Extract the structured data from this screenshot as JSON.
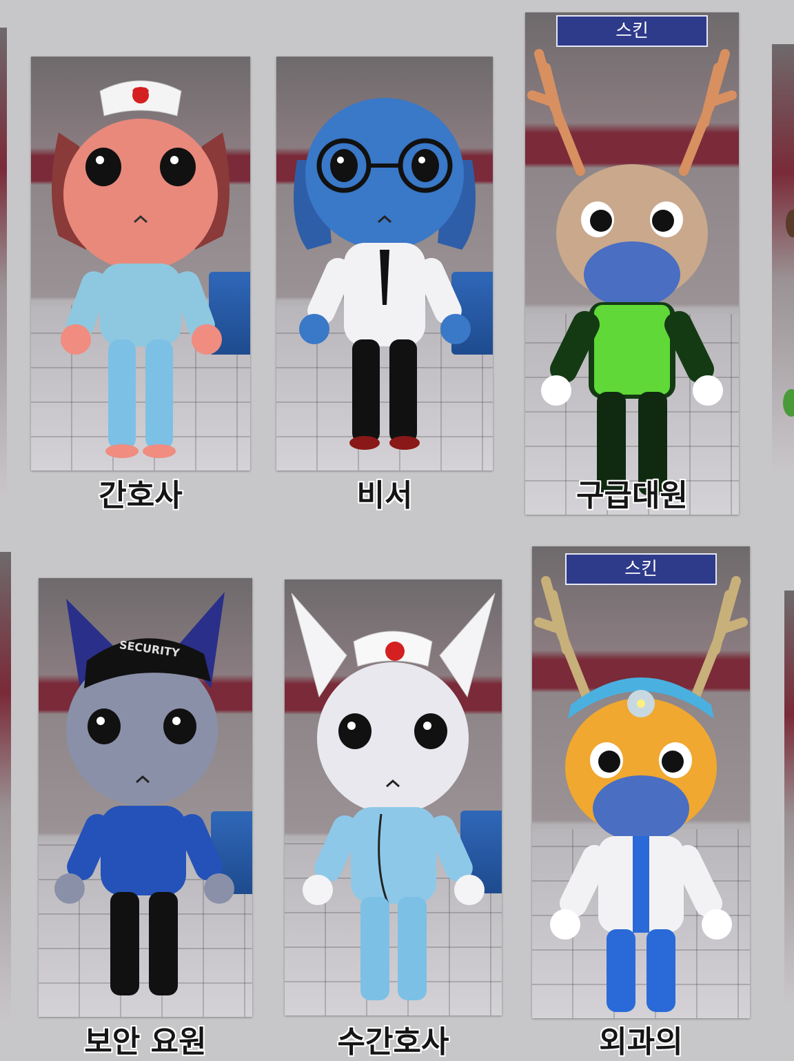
{
  "badges": {
    "skin": "스킨"
  },
  "characters": {
    "nurse": {
      "name": "간호사"
    },
    "secretary": {
      "name": "비서"
    },
    "paramedic": {
      "name": "구급대원",
      "skin": "스킨"
    },
    "security": {
      "name": "보안 요원",
      "cap_text": "SECURITY"
    },
    "head_nurse": {
      "name": "수간호사"
    },
    "surgeon": {
      "name": "외과의",
      "skin": "스킨"
    }
  }
}
